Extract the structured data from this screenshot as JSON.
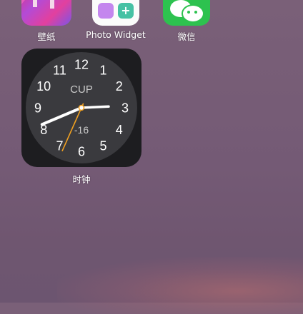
{
  "apps": {
    "wallpaper": {
      "label": "壁纸",
      "icon": "wallpaper-app-icon"
    },
    "photo_widget": {
      "label": "Photo Widget",
      "icon": "photo-widget-app-icon",
      "plus": "+"
    },
    "wechat": {
      "label": "微信",
      "icon": "wechat-app-icon"
    }
  },
  "clock_widget": {
    "label": "时钟",
    "city": "CUP",
    "offset": "-16",
    "numbers": [
      "12",
      "1",
      "2",
      "3",
      "4",
      "5",
      "6",
      "7",
      "8",
      "9",
      "10",
      "11"
    ],
    "time": {
      "hour": 8,
      "minute": 14,
      "second": 34
    },
    "second_hand_color": "#f0a020"
  }
}
